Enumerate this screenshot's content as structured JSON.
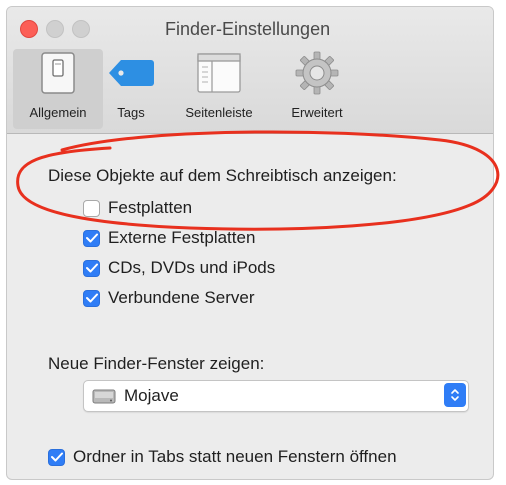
{
  "window": {
    "title": "Finder-Einstellungen"
  },
  "toolbar": {
    "items": [
      {
        "label": "Allgemein",
        "selected": true
      },
      {
        "label": "Tags",
        "selected": false
      },
      {
        "label": "Seitenleiste",
        "selected": false
      },
      {
        "label": "Erweitert",
        "selected": false
      }
    ]
  },
  "desktop_section": {
    "heading": "Diese Objekte auf dem Schreibtisch anzeigen:",
    "options": [
      {
        "label": "Festplatten",
        "checked": false
      },
      {
        "label": "Externe Festplatten",
        "checked": true
      },
      {
        "label": "CDs, DVDs und iPods",
        "checked": true
      },
      {
        "label": "Verbundene Server",
        "checked": true
      }
    ]
  },
  "new_window_section": {
    "heading": "Neue Finder-Fenster zeigen:",
    "selected_value": "Mojave"
  },
  "tabs_option": {
    "label": "Ordner in Tabs statt neuen Fenstern öffnen",
    "checked": true
  },
  "colors": {
    "accent": "#2f7df6",
    "annotation": "#e8301e",
    "close_button": "#fc5f57"
  }
}
